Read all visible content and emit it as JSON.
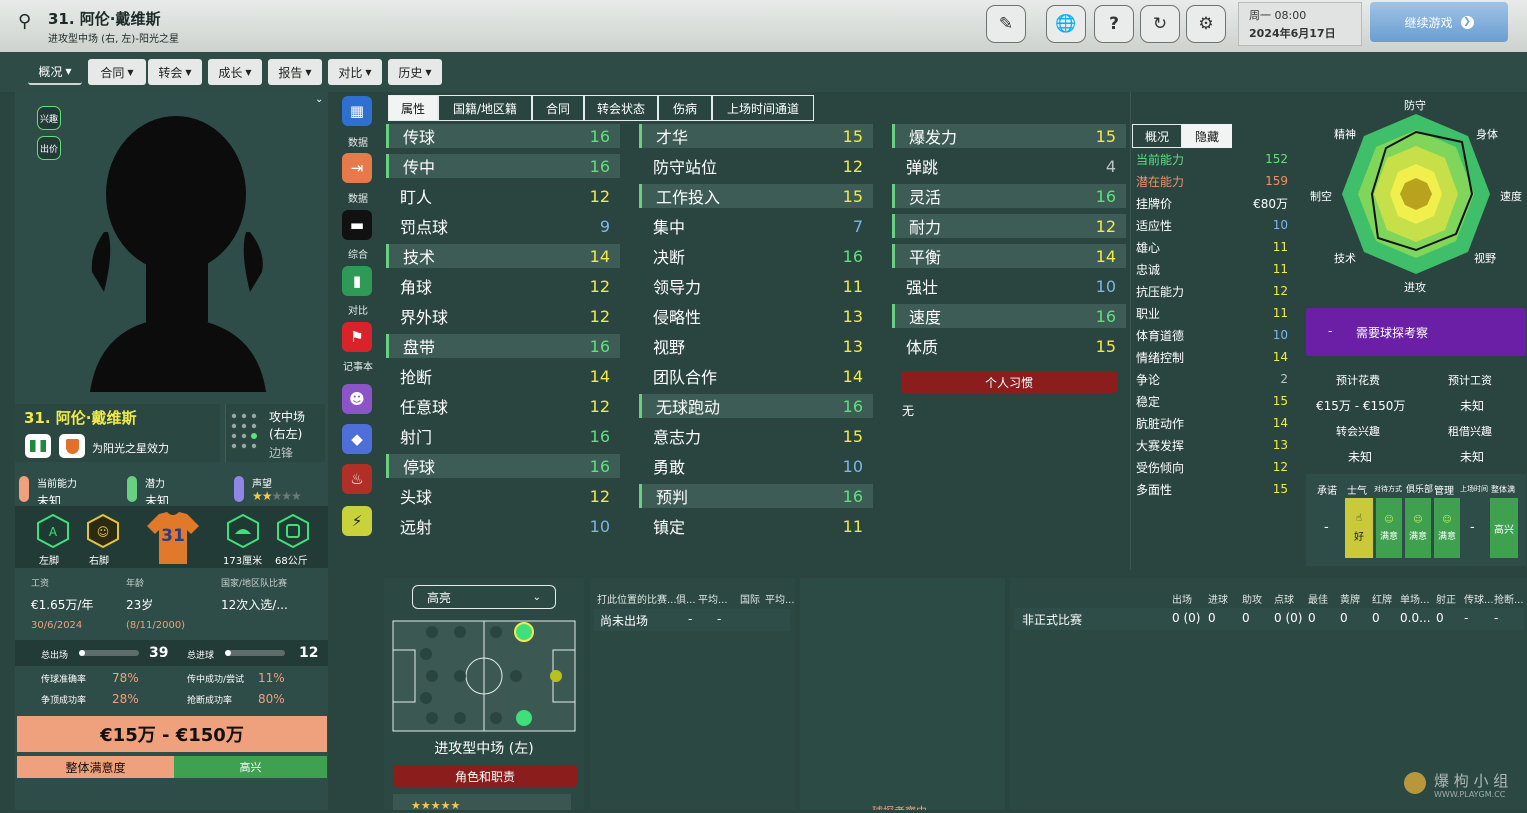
{
  "header": {
    "title": "31. 阿伦·戴维斯",
    "subtitle": "进攻型中场 (右, 左)-阳光之星",
    "day": "周一 08:00",
    "date": "2024年6月17日",
    "continue": "继续游戏"
  },
  "nav": [
    "概况",
    "合同",
    "转会",
    "成长",
    "报告",
    "对比",
    "历史"
  ],
  "left": {
    "btn_interest": "兴趣",
    "btn_bid": "出价",
    "name": "31. 阿伦·戴维斯",
    "club": "为阳光之星效力",
    "position": "攻中场",
    "position2": "(右左)",
    "role": "边锋",
    "ca_label": "当前能力",
    "ca_value": "未知",
    "pa_label": "潜力",
    "pa_value": "未知",
    "rep_label": "声望",
    "foot_left": "左脚",
    "foot_right": "右脚",
    "shirt": "31",
    "height": "173厘米",
    "weight": "68公斤",
    "wage_label": "工资",
    "wage": "€1.65万/年",
    "expiry": "30/6/2024",
    "age_label": "年龄",
    "age": "23岁",
    "dob": "(8/11/2000)",
    "intl_label": "国家/地区队比赛",
    "intl": "12次入选/...",
    "apps_label": "总出场",
    "apps": "39",
    "goals_label": "总进球",
    "goals": "12",
    "pass_label": "传球准确率",
    "pass": "78%",
    "cross_label": "传中成功/尝试",
    "cross": "11%",
    "duel_label": "争顶成功率",
    "duel": "28%",
    "tackle_label": "抢断成功率",
    "tackle": "80%",
    "value": "€15万 - €150万",
    "sat_label": "整体满意度",
    "sat": "高兴"
  },
  "side": [
    "数据",
    "数据",
    "综合",
    "对比",
    "记事本"
  ],
  "tabs": [
    "属性",
    "国籍/地区籍",
    "合同",
    "转会状态",
    "伤病",
    "上场时间通道"
  ],
  "attrs_col1": [
    {
      "n": "传球",
      "v": "16",
      "c": "g",
      "h": true
    },
    {
      "n": "传中",
      "v": "16",
      "c": "g",
      "h": true
    },
    {
      "n": "盯人",
      "v": "12",
      "c": "y"
    },
    {
      "n": "罚点球",
      "v": "9",
      "c": "b"
    },
    {
      "n": "技术",
      "v": "14",
      "c": "y",
      "h": true
    },
    {
      "n": "角球",
      "v": "12",
      "c": "y"
    },
    {
      "n": "界外球",
      "v": "12",
      "c": "y"
    },
    {
      "n": "盘带",
      "v": "16",
      "c": "g",
      "h": true
    },
    {
      "n": "抢断",
      "v": "14",
      "c": "y"
    },
    {
      "n": "任意球",
      "v": "12",
      "c": "y"
    },
    {
      "n": "射门",
      "v": "16",
      "c": "g"
    },
    {
      "n": "停球",
      "v": "16",
      "c": "g",
      "h": true
    },
    {
      "n": "头球",
      "v": "12",
      "c": "y"
    },
    {
      "n": "远射",
      "v": "10",
      "c": "b"
    }
  ],
  "attrs_col2": [
    {
      "n": "才华",
      "v": "15",
      "c": "y",
      "h": true
    },
    {
      "n": "防守站位",
      "v": "12",
      "c": "y"
    },
    {
      "n": "工作投入",
      "v": "15",
      "c": "y",
      "h": true
    },
    {
      "n": "集中",
      "v": "7",
      "c": "b"
    },
    {
      "n": "决断",
      "v": "16",
      "c": "g"
    },
    {
      "n": "领导力",
      "v": "11",
      "c": "y"
    },
    {
      "n": "侵略性",
      "v": "13",
      "c": "y"
    },
    {
      "n": "视野",
      "v": "13",
      "c": "y"
    },
    {
      "n": "团队合作",
      "v": "14",
      "c": "y"
    },
    {
      "n": "无球跑动",
      "v": "16",
      "c": "g",
      "h": true
    },
    {
      "n": "意志力",
      "v": "15",
      "c": "y"
    },
    {
      "n": "勇敢",
      "v": "10",
      "c": "b"
    },
    {
      "n": "预判",
      "v": "16",
      "c": "g",
      "h": true
    },
    {
      "n": "镇定",
      "v": "11",
      "c": "y"
    }
  ],
  "attrs_col3": [
    {
      "n": "爆发力",
      "v": "15",
      "c": "y",
      "h": true
    },
    {
      "n": "弹跳",
      "v": "4",
      "c": "gr"
    },
    {
      "n": "灵活",
      "v": "16",
      "c": "g",
      "h": true
    },
    {
      "n": "耐力",
      "v": "12",
      "c": "y",
      "h": true
    },
    {
      "n": "平衡",
      "v": "14",
      "c": "y",
      "h": true
    },
    {
      "n": "强壮",
      "v": "10",
      "c": "b"
    },
    {
      "n": "速度",
      "v": "16",
      "c": "g",
      "h": true
    },
    {
      "n": "体质",
      "v": "15",
      "c": "y"
    }
  ],
  "traits": {
    "title": "个人习惯",
    "value": "无"
  },
  "hidden": {
    "tab1": "概况",
    "tab2": "隐藏",
    "rows": [
      {
        "n": "当前能力",
        "v": "152",
        "nc": "#5fe07b",
        "vc": "#5fe07b"
      },
      {
        "n": "潜在能力",
        "v": "159",
        "nc": "#f0906a",
        "vc": "#f0906a"
      },
      {
        "n": "挂牌价",
        "v": "€80万"
      },
      {
        "n": "适应性",
        "v": "10",
        "vc": "#7fb5ea"
      },
      {
        "n": "雄心",
        "v": "11",
        "vc": "#f2e94a"
      },
      {
        "n": "忠诚",
        "v": "11",
        "vc": "#f2e94a"
      },
      {
        "n": "抗压能力",
        "v": "12",
        "vc": "#f2e94a"
      },
      {
        "n": "职业",
        "v": "11",
        "vc": "#f2e94a"
      },
      {
        "n": "体育道德",
        "v": "10",
        "vc": "#7fb5ea"
      },
      {
        "n": "情绪控制",
        "v": "14",
        "vc": "#f2e94a"
      },
      {
        "n": "争论",
        "v": "2",
        "vc": "#bfc5c3"
      },
      {
        "n": "稳定",
        "v": "15",
        "vc": "#f2e94a"
      },
      {
        "n": "肮脏动作",
        "v": "14",
        "vc": "#f2e94a"
      },
      {
        "n": "大赛发挥",
        "v": "13",
        "vc": "#f2e94a"
      },
      {
        "n": "受伤倾向",
        "v": "12",
        "vc": "#f2e94a"
      },
      {
        "n": "多面性",
        "v": "15",
        "vc": "#f2e94a"
      }
    ]
  },
  "radar": {
    "labels": [
      "防守",
      "身体",
      "速度",
      "视野",
      "进攻",
      "技术",
      "制空",
      "精神"
    ]
  },
  "scout": {
    "banner": "需要球探考察",
    "dash": "-",
    "cost_label": "预计花费",
    "wage_label": "预计工资",
    "cost": "€15万 - €150万",
    "wage": "未知",
    "transfer_label": "转会兴趣",
    "loan_label": "租借兴趣",
    "transfer": "未知",
    "loan": "未知"
  },
  "morale": {
    "headers": [
      "承诺",
      "士气",
      "对待方式",
      "俱乐部",
      "管理",
      "上场时间",
      "整体满"
    ],
    "dash": "-",
    "good": "好",
    "ok": "满意",
    "happy": "高兴"
  },
  "pitch": {
    "dropdown": "高亮",
    "position": "进攻型中场 (左)",
    "roles_btn": "角色和职责"
  },
  "mid": {
    "headers": [
      "打此位置的比赛...",
      "俱...",
      "平均...",
      "国际",
      "平均..."
    ],
    "row": "尚未出场",
    "dash": "-"
  },
  "stats": {
    "headers": [
      "出场",
      "进球",
      "助攻",
      "点球",
      "最佳",
      "黄牌",
      "红牌",
      "单场...",
      "射正",
      "传球...",
      "抢断..."
    ],
    "row_label": "非正式比赛",
    "values": [
      "0 (0)",
      "0",
      "0",
      "0 (0)",
      "0",
      "0",
      "0",
      "0.0...",
      "0",
      "-",
      "-"
    ]
  },
  "footer_partial": "球探考察中"
}
